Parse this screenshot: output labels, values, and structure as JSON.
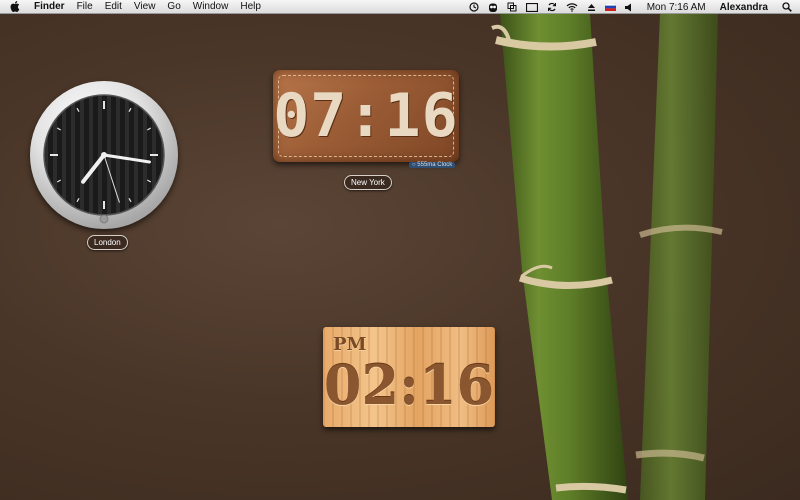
{
  "menubar": {
    "app_name": "Finder",
    "menus": [
      "File",
      "Edit",
      "View",
      "Go",
      "Window",
      "Help"
    ],
    "status_icons": [
      "time-machine-icon",
      "owl-icon",
      "copy-icon",
      "display-icon",
      "sync-icon",
      "wifi-icon",
      "eject-icon",
      "flag-icon",
      "volume-icon"
    ],
    "clock": "Mon 7:16 AM",
    "user": "Alexandra",
    "spotlight_icon": "search-icon"
  },
  "widgets": {
    "analog": {
      "city": "London",
      "hour": 7,
      "minute": 16,
      "second": 27
    },
    "leather": {
      "time": "07:16",
      "city": "New York",
      "tag": "○ 555ma Clock"
    },
    "wood": {
      "ampm": "PM",
      "time": "02:16"
    }
  },
  "colors": {
    "desktop": "#4a3628",
    "bamboo": "#5c7a2a",
    "leather": "#9a5c35",
    "wood": "#e8aa6a"
  }
}
